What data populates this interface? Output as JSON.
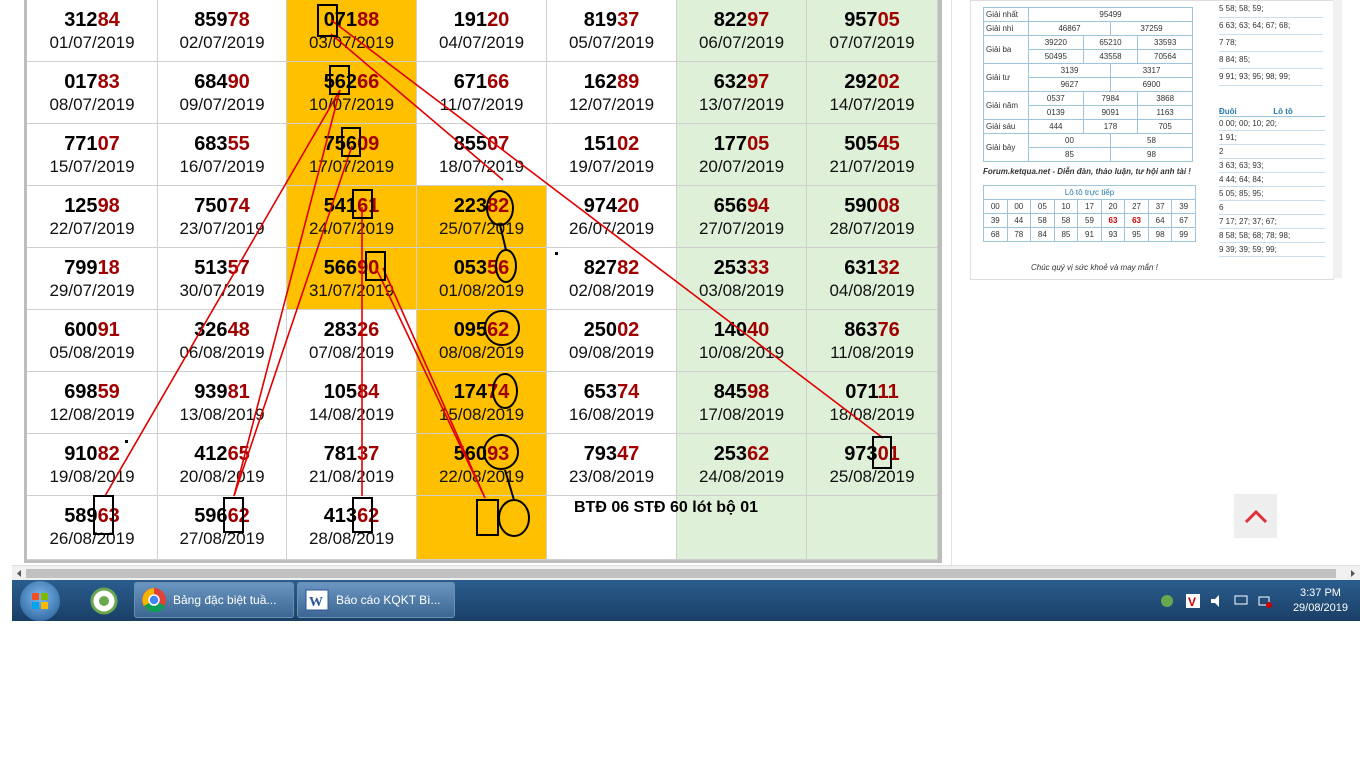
{
  "grid": {
    "rows": [
      [
        {
          "num": "31284",
          "date": "01/07/2019"
        },
        {
          "num": "85978",
          "date": "02/07/2019"
        },
        {
          "num": "07188",
          "date": "03/07/2019"
        },
        {
          "num": "19120",
          "date": "04/07/2019"
        },
        {
          "num": "81937",
          "date": "05/07/2019"
        },
        {
          "num": "82297",
          "date": "06/07/2019"
        },
        {
          "num": "95705",
          "date": "07/07/2019"
        }
      ],
      [
        {
          "num": "01783",
          "date": "08/07/2019"
        },
        {
          "num": "68490",
          "date": "09/07/2019"
        },
        {
          "num": "56266",
          "date": "10/07/2019"
        },
        {
          "num": "67166",
          "date": "11/07/2019"
        },
        {
          "num": "16289",
          "date": "12/07/2019"
        },
        {
          "num": "63297",
          "date": "13/07/2019"
        },
        {
          "num": "29202",
          "date": "14/07/2019"
        }
      ],
      [
        {
          "num": "77107",
          "date": "15/07/2019"
        },
        {
          "num": "68355",
          "date": "16/07/2019"
        },
        {
          "num": "75609",
          "date": "17/07/2019"
        },
        {
          "num": "85507",
          "date": "18/07/2019"
        },
        {
          "num": "15102",
          "date": "19/07/2019"
        },
        {
          "num": "17705",
          "date": "20/07/2019"
        },
        {
          "num": "50545",
          "date": "21/07/2019"
        }
      ],
      [
        {
          "num": "12598",
          "date": "22/07/2019"
        },
        {
          "num": "75074",
          "date": "23/07/2019"
        },
        {
          "num": "54161",
          "date": "24/07/2019"
        },
        {
          "num": "22382",
          "date": "25/07/2019"
        },
        {
          "num": "97420",
          "date": "26/07/2019"
        },
        {
          "num": "65694",
          "date": "27/07/2019"
        },
        {
          "num": "59008",
          "date": "28/07/2019"
        }
      ],
      [
        {
          "num": "79918",
          "date": "29/07/2019"
        },
        {
          "num": "51357",
          "date": "30/07/2019"
        },
        {
          "num": "56690",
          "date": "31/07/2019"
        },
        {
          "num": "05356",
          "date": "01/08/2019"
        },
        {
          "num": "82782",
          "date": "02/08/2019"
        },
        {
          "num": "25333",
          "date": "03/08/2019"
        },
        {
          "num": "63132",
          "date": "04/08/2019"
        }
      ],
      [
        {
          "num": "60091",
          "date": "05/08/2019"
        },
        {
          "num": "32648",
          "date": "06/08/2019"
        },
        {
          "num": "28326",
          "date": "07/08/2019"
        },
        {
          "num": "09562",
          "date": "08/08/2019"
        },
        {
          "num": "25002",
          "date": "09/08/2019"
        },
        {
          "num": "14040",
          "date": "10/08/2019"
        },
        {
          "num": "86376",
          "date": "11/08/2019"
        }
      ],
      [
        {
          "num": "69859",
          "date": "12/08/2019"
        },
        {
          "num": "93981",
          "date": "13/08/2019"
        },
        {
          "num": "10584",
          "date": "14/08/2019"
        },
        {
          "num": "17474",
          "date": "15/08/2019"
        },
        {
          "num": "65374",
          "date": "16/08/2019"
        },
        {
          "num": "84598",
          "date": "17/08/2019"
        },
        {
          "num": "07111",
          "date": "18/08/2019"
        }
      ],
      [
        {
          "num": "91082",
          "date": "19/08/2019"
        },
        {
          "num": "41265",
          "date": "20/08/2019"
        },
        {
          "num": "78137",
          "date": "21/08/2019"
        },
        {
          "num": "56093",
          "date": "22/08/2019"
        },
        {
          "num": "79347",
          "date": "23/08/2019"
        },
        {
          "num": "25362",
          "date": "24/08/2019"
        },
        {
          "num": "97301",
          "date": "25/08/2019"
        }
      ],
      [
        {
          "num": "58963",
          "date": "26/08/2019"
        },
        {
          "num": "59662",
          "date": "27/08/2019"
        },
        {
          "num": "41362",
          "date": "28/08/2019"
        },
        {
          "num": "",
          "date": ""
        },
        {
          "num": "",
          "date": ""
        },
        {
          "num": "",
          "date": ""
        },
        {
          "num": "",
          "date": ""
        }
      ]
    ]
  },
  "note": "BTĐ 06 STĐ 60 lót bộ 01",
  "thumbnail": {
    "prizes": [
      {
        "label": "Giải nhất",
        "values": [
          "95499"
        ]
      },
      {
        "label": "Giải nhì",
        "values": [
          "46867",
          "37259"
        ]
      },
      {
        "label": "Giải ba",
        "values": [
          "39220",
          "65210",
          "33593",
          "50495",
          "43558",
          "70564"
        ]
      },
      {
        "label": "Giải tư",
        "values": [
          "3139",
          "3317",
          "9627",
          "6900"
        ]
      },
      {
        "label": "Giải năm",
        "values": [
          "0537",
          "7984",
          "3868",
          "0139",
          "9091",
          "1163"
        ]
      },
      {
        "label": "Giải sáu",
        "values": [
          "444",
          "178",
          "705"
        ]
      },
      {
        "label": "Giải bảy",
        "values": [
          "00",
          "58",
          "85",
          "98"
        ]
      }
    ],
    "forum_text": "Forum.ketqua.net - Diễn đàn, thảo luận, tư hội anh tài !",
    "loto_title": "Lô tô trực tiếp",
    "loto": [
      "00",
      "00",
      "05",
      "10",
      "17",
      "20",
      "27",
      "37",
      "39",
      "39",
      "44",
      "58",
      "58",
      "59",
      "63",
      "63",
      "64",
      "67",
      "68",
      "78",
      "84",
      "85",
      "91",
      "93",
      "95",
      "98",
      "99"
    ],
    "loto_highlight": "63",
    "footer": "Chúc quý vị sức khoẻ và may mắn !",
    "top_right_rows": [
      "5  58; 58; 59;",
      "6  63; 63; 64; 67; 68;",
      "7  78;",
      "8  84; 85;",
      "9  91; 93; 95; 98; 99;"
    ],
    "duoi_header": [
      "Đuôi",
      "Lô tô"
    ],
    "duoi_rows": [
      "0  00; 00; 10; 20;",
      "1  91;",
      "2",
      "3  63; 63; 93;",
      "4  44; 64; 84;",
      "5  05; 85; 95;",
      "6",
      "7  17; 27; 37; 67;",
      "8  58; 58; 68; 78; 98;",
      "9  39; 39; 59; 99;"
    ]
  },
  "taskbar": {
    "apps": [
      {
        "label": "Bảng đặc biệt tuầ...",
        "icon": "chrome-icon"
      },
      {
        "label": "Báo cáo KQKT Bì...",
        "icon": "word-icon"
      }
    ],
    "time": "3:37 PM",
    "date": "29/08/2019"
  },
  "colors": {
    "orange": "#ffc000",
    "green": "#dff0d8",
    "accent_red": "#a00000",
    "line_red": "#e00000"
  }
}
